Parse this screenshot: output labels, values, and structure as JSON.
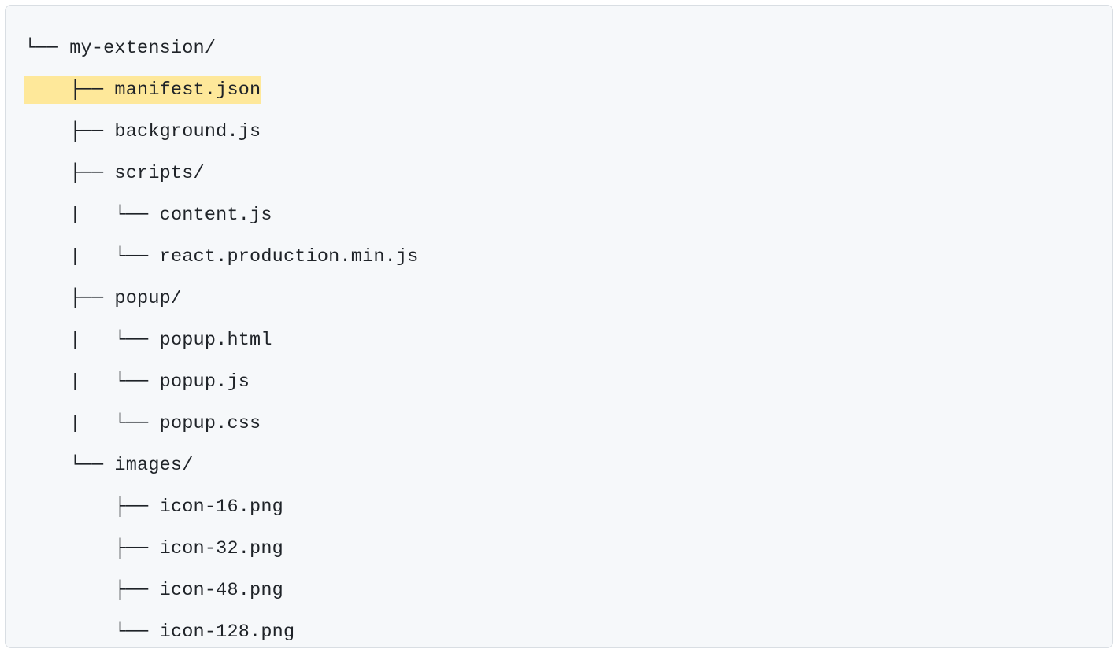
{
  "tree": {
    "lines": [
      {
        "prefix": "└── ",
        "name": "my-extension/",
        "highlight": false
      },
      {
        "prefix": "    ├── ",
        "name": "manifest.json",
        "highlight": true
      },
      {
        "prefix": "    ├── ",
        "name": "background.js",
        "highlight": false
      },
      {
        "prefix": "    ├── ",
        "name": "scripts/",
        "highlight": false
      },
      {
        "prefix": "    |   └── ",
        "name": "content.js",
        "highlight": false
      },
      {
        "prefix": "    |   └── ",
        "name": "react.production.min.js",
        "highlight": false
      },
      {
        "prefix": "    ├── ",
        "name": "popup/",
        "highlight": false
      },
      {
        "prefix": "    |   └── ",
        "name": "popup.html",
        "highlight": false
      },
      {
        "prefix": "    |   └── ",
        "name": "popup.js",
        "highlight": false
      },
      {
        "prefix": "    |   └── ",
        "name": "popup.css",
        "highlight": false
      },
      {
        "prefix": "    └── ",
        "name": "images/",
        "highlight": false
      },
      {
        "prefix": "        ├── ",
        "name": "icon-16.png",
        "highlight": false
      },
      {
        "prefix": "        ├── ",
        "name": "icon-32.png",
        "highlight": false
      },
      {
        "prefix": "        ├── ",
        "name": "icon-48.png",
        "highlight": false
      },
      {
        "prefix": "        └── ",
        "name": "icon-128.png",
        "highlight": false
      }
    ]
  }
}
